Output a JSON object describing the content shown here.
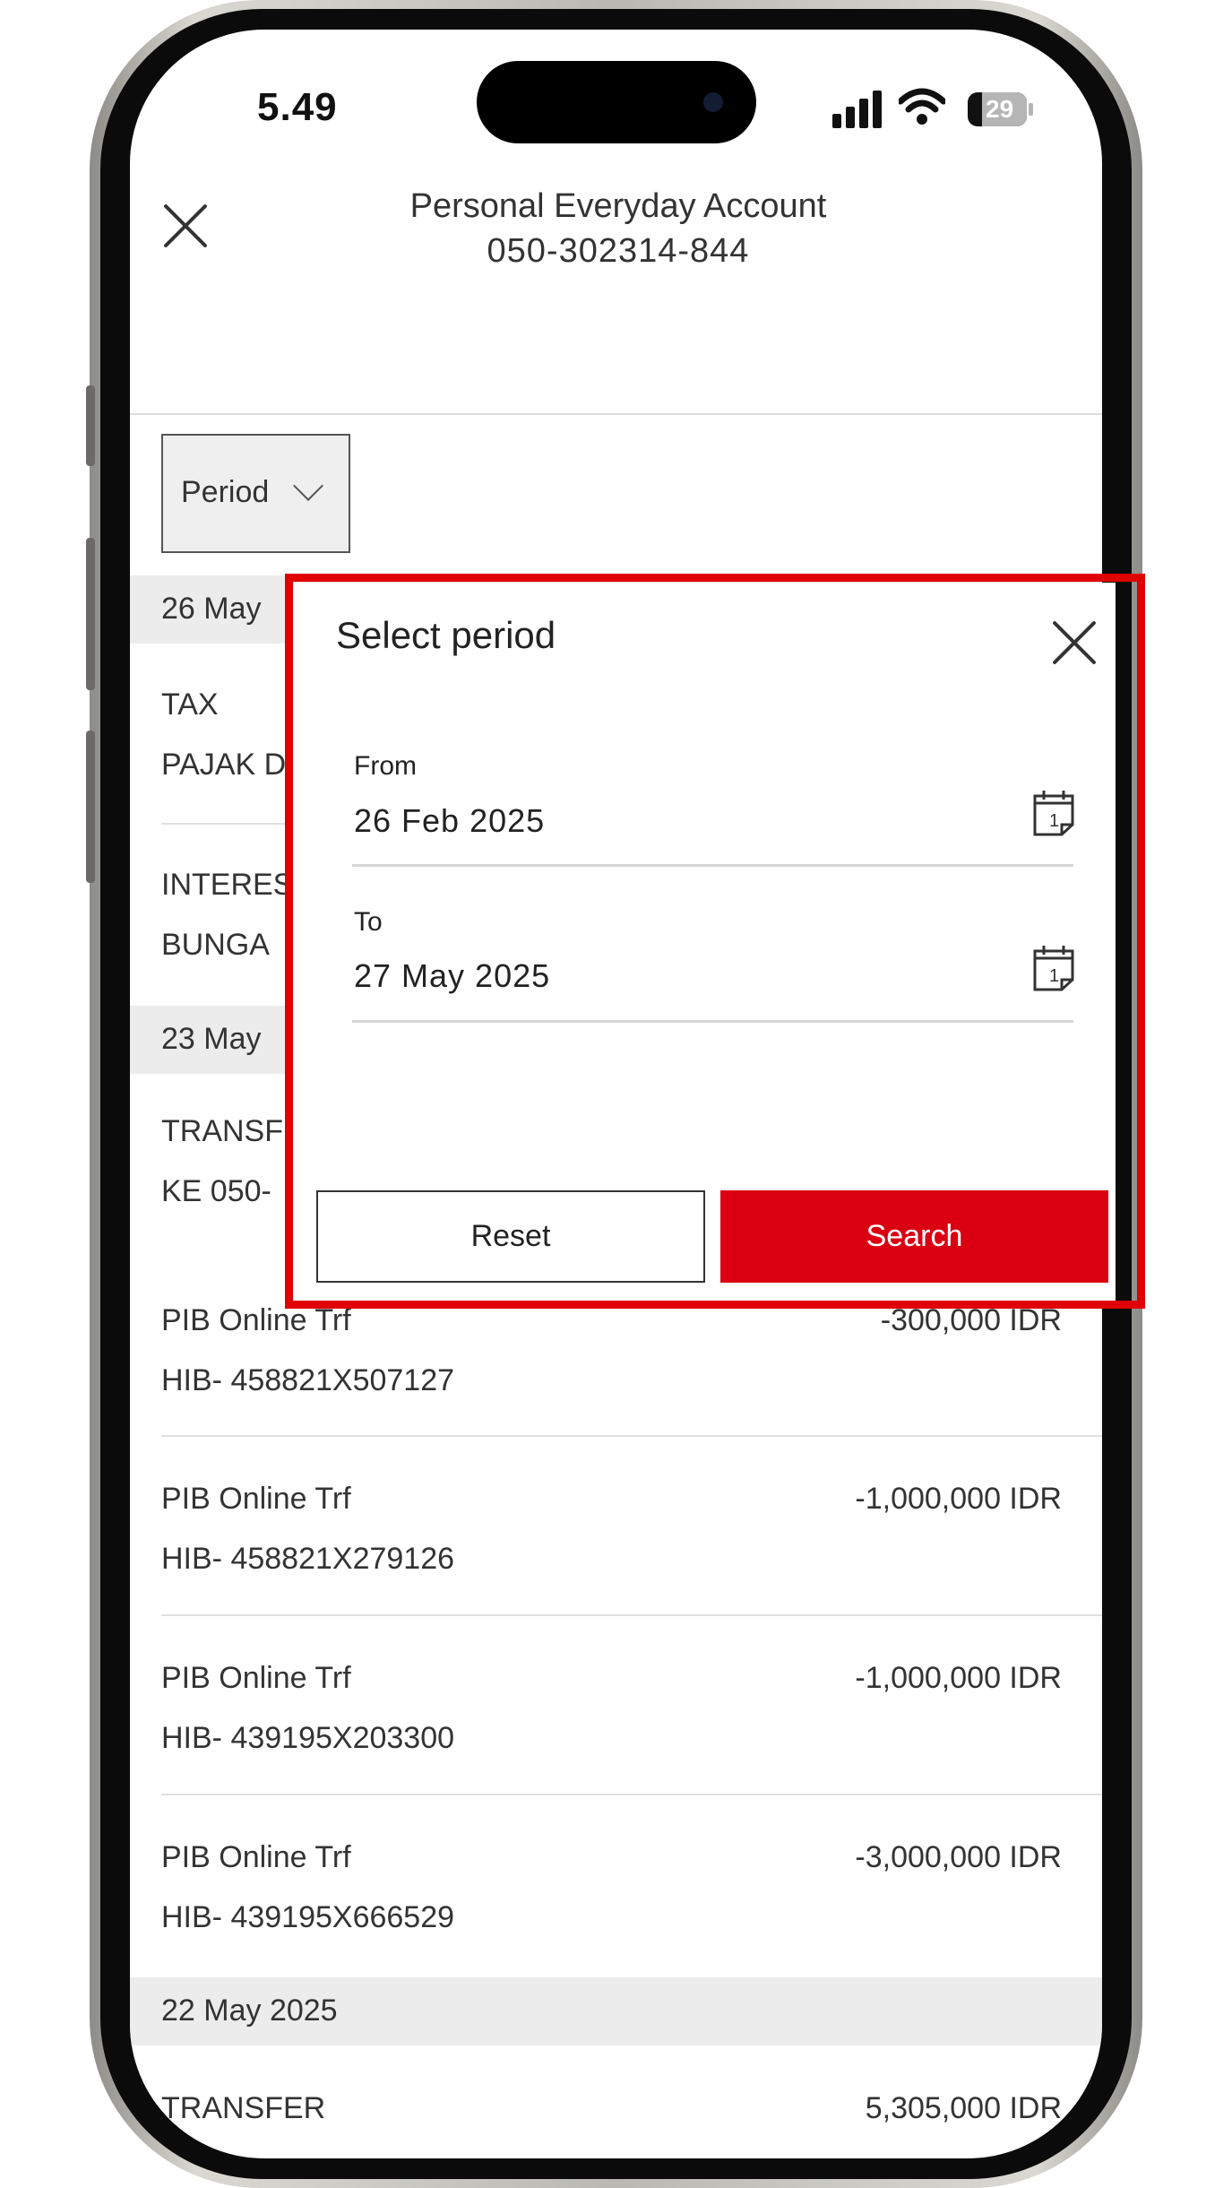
{
  "status_bar": {
    "time": "5.49",
    "battery": "29"
  },
  "header": {
    "title": "Personal Everyday Account",
    "account_number": "050-302314-844"
  },
  "filter": {
    "label": "Period"
  },
  "dates": {
    "d1": "26 May",
    "d2": "23 May",
    "d3": "22 May 2025"
  },
  "transactions": [
    {
      "line1": "TAX",
      "line2": "PAJAK D",
      "amount": ""
    },
    {
      "line1": "INTERES",
      "line2": "BUNGA",
      "amount": ""
    },
    {
      "line1": "TRANSF",
      "line2": "KE 050-",
      "amount": ""
    },
    {
      "line1": "PIB Online Trf",
      "line2": "HIB- 458821X507127",
      "amount": "-300,000 IDR"
    },
    {
      "line1": "PIB Online Trf",
      "line2": "HIB- 458821X279126",
      "amount": "-1,000,000 IDR"
    },
    {
      "line1": "PIB Online Trf",
      "line2": "HIB- 439195X203300",
      "amount": "-1,000,000 IDR"
    },
    {
      "line1": "PIB Online Trf",
      "line2": "HIB- 439195X666529",
      "amount": "-3,000,000 IDR"
    },
    {
      "line1": "TRANSFER",
      "line2": "",
      "amount": "5,305,000 IDR"
    }
  ],
  "modal": {
    "title": "Select period",
    "from_label": "From",
    "from_value": "26 Feb 2025",
    "to_label": "To",
    "to_value": "27 May 2025",
    "calendar_day": "1",
    "reset_label": "Reset",
    "search_label": "Search"
  },
  "colors": {
    "accent": "#db0011",
    "highlight_border": "#e00000"
  }
}
